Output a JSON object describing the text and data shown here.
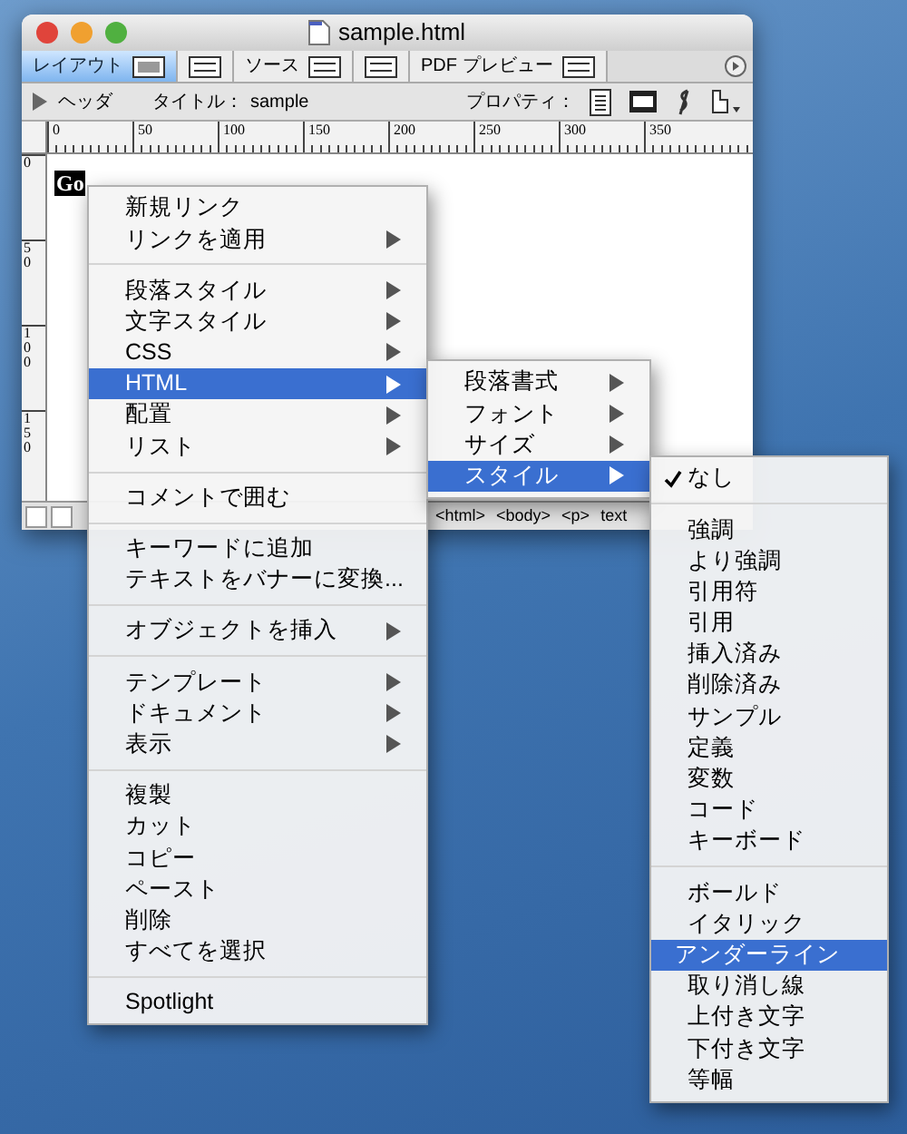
{
  "window": {
    "title": "sample.html"
  },
  "toolbar": {
    "tabs": [
      {
        "kind": "text",
        "label": "レイアウト",
        "selected": true
      },
      {
        "kind": "icon",
        "selected": false
      },
      {
        "kind": "text",
        "label": "ソース",
        "selected": false
      },
      {
        "kind": "icon",
        "selected": false
      },
      {
        "kind": "text",
        "label": "PDF プレビュー",
        "selected": false
      }
    ]
  },
  "header": {
    "disclosure_label": "ヘッダ",
    "title_label": "タイトル：",
    "title_value": "sample",
    "properties_label": "プロパティ："
  },
  "ruler": {
    "marks": [
      "0",
      "50",
      "100",
      "150",
      "200",
      "250",
      "300",
      "350"
    ],
    "vertical_marks": [
      "0",
      "50",
      "100",
      "150"
    ]
  },
  "document": {
    "selected_text": "Go"
  },
  "status_bar": {
    "breadcrumbs": [
      "<html>",
      "<body>",
      "<p>",
      "text"
    ]
  },
  "context_menu": {
    "groups": [
      {
        "items": [
          {
            "label": "新規リンク",
            "submenu": false,
            "selected": false
          },
          {
            "label": "リンクを適用",
            "submenu": true,
            "selected": false
          }
        ]
      },
      {
        "items": [
          {
            "label": "段落スタイル",
            "submenu": true,
            "selected": false
          },
          {
            "label": "文字スタイル",
            "submenu": true,
            "selected": false
          },
          {
            "label": "CSS",
            "submenu": true,
            "selected": false
          },
          {
            "label": "HTML",
            "submenu": true,
            "selected": true
          },
          {
            "label": "配置",
            "submenu": true,
            "selected": false
          },
          {
            "label": "リスト",
            "submenu": true,
            "selected": false
          }
        ]
      },
      {
        "items": [
          {
            "label": "コメントで囲む",
            "submenu": false,
            "selected": false
          }
        ]
      },
      {
        "items": [
          {
            "label": "キーワードに追加",
            "submenu": false,
            "selected": false
          },
          {
            "label": "テキストをバナーに変換...",
            "submenu": false,
            "selected": false
          }
        ]
      },
      {
        "items": [
          {
            "label": "オブジェクトを挿入",
            "submenu": true,
            "selected": false
          }
        ]
      },
      {
        "items": [
          {
            "label": "テンプレート",
            "submenu": true,
            "selected": false
          },
          {
            "label": "ドキュメント",
            "submenu": true,
            "selected": false
          },
          {
            "label": "表示",
            "submenu": true,
            "selected": false
          }
        ]
      },
      {
        "items": [
          {
            "label": "複製",
            "submenu": false,
            "selected": false
          },
          {
            "label": "カット",
            "submenu": false,
            "selected": false
          },
          {
            "label": "コピー",
            "submenu": false,
            "selected": false
          },
          {
            "label": "ペースト",
            "submenu": false,
            "selected": false
          },
          {
            "label": "削除",
            "submenu": false,
            "selected": false
          },
          {
            "label": "すべてを選択",
            "submenu": false,
            "selected": false
          }
        ]
      },
      {
        "items": [
          {
            "label": "Spotlight",
            "submenu": false,
            "selected": false
          }
        ]
      }
    ]
  },
  "html_submenu": {
    "groups": [
      {
        "items": [
          {
            "label": "段落書式",
            "submenu": true,
            "selected": false
          },
          {
            "label": "フォント",
            "submenu": true,
            "selected": false
          },
          {
            "label": "サイズ",
            "submenu": true,
            "selected": false
          },
          {
            "label": "スタイル",
            "submenu": true,
            "selected": true
          }
        ]
      }
    ]
  },
  "style_submenu": {
    "groups": [
      {
        "items": [
          {
            "label": "なし",
            "checked": true,
            "selected": false
          }
        ]
      },
      {
        "items": [
          {
            "label": "強調",
            "checked": false,
            "selected": false
          },
          {
            "label": "より強調",
            "checked": false,
            "selected": false
          },
          {
            "label": "引用符",
            "checked": false,
            "selected": false
          },
          {
            "label": "引用",
            "checked": false,
            "selected": false
          },
          {
            "label": "挿入済み",
            "checked": false,
            "selected": false
          },
          {
            "label": "削除済み",
            "checked": false,
            "selected": false
          },
          {
            "label": "サンプル",
            "checked": false,
            "selected": false
          },
          {
            "label": "定義",
            "checked": false,
            "selected": false
          },
          {
            "label": "変数",
            "checked": false,
            "selected": false
          },
          {
            "label": "コード",
            "checked": false,
            "selected": false
          },
          {
            "label": "キーボード",
            "checked": false,
            "selected": false
          }
        ]
      },
      {
        "items": [
          {
            "label": "ボールド",
            "checked": false,
            "selected": false
          },
          {
            "label": "イタリック",
            "checked": false,
            "selected": false
          },
          {
            "label": "アンダーライン",
            "checked": false,
            "selected": true
          },
          {
            "label": "取り消し線",
            "checked": false,
            "selected": false
          },
          {
            "label": "上付き文字",
            "checked": false,
            "selected": false
          },
          {
            "label": "下付き文字",
            "checked": false,
            "selected": false
          },
          {
            "label": "等幅",
            "checked": false,
            "selected": false
          }
        ]
      }
    ]
  }
}
